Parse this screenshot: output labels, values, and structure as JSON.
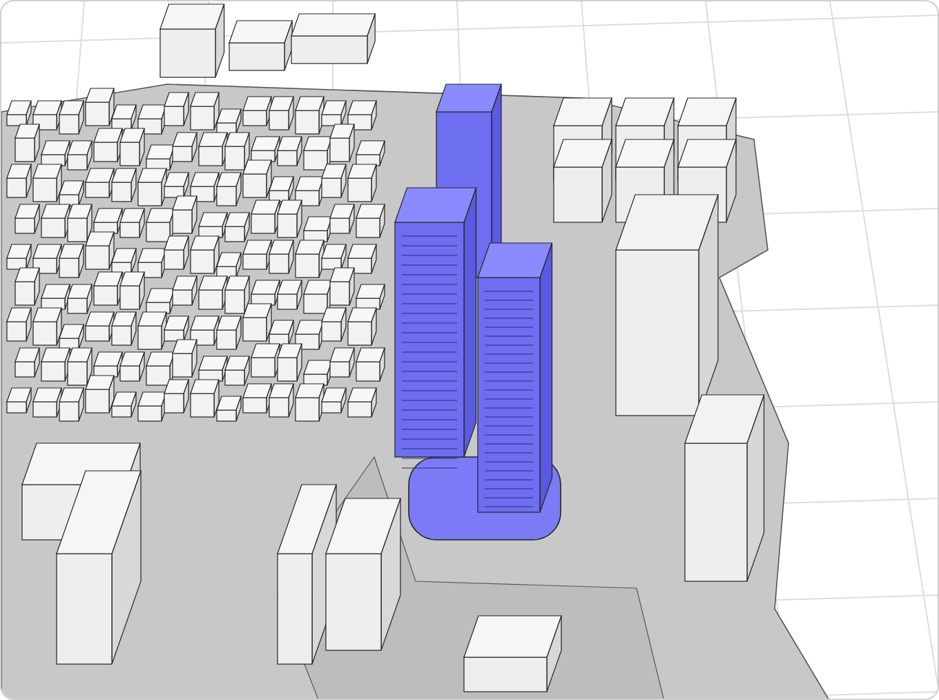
{
  "scene": {
    "kind": "city-model"
  }
}
